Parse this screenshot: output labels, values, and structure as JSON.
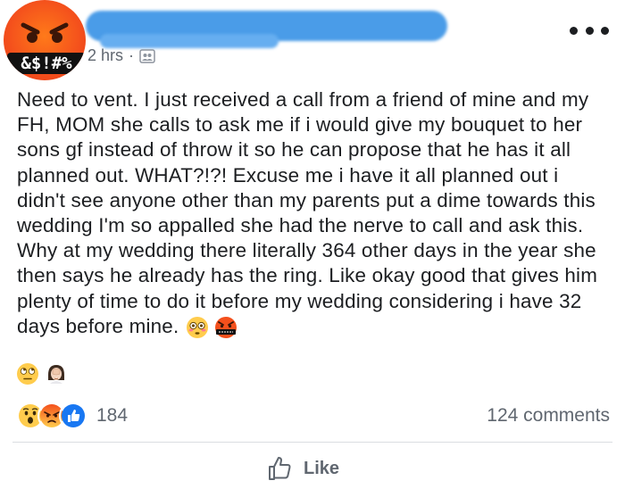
{
  "post": {
    "avatar_badge": "&$!#%",
    "timestamp": "2 hrs",
    "separator": "·",
    "body_text": "Need to vent. I just received a call from a friend of mine and my FH, MOM she calls to ask me if i would give my bouquet to her sons gf instead of throw it so he can propose that he has it all planned out. WHAT?!?! Excuse me i have it all planned out i didn't see anyone other than my parents put a dime towards this wedding I'm so appalled she had the nerve to call and ask this. Why at my wedding there literally 364 other days in the year she then says he already has the ring. Like okay good that gives him plenty of time to do it before my wedding considering i have 32 days before mine.",
    "trailing_emojis": [
      "flushed-face",
      "cursing-face",
      "eye-roll-face",
      "facepalm-woman"
    ]
  },
  "reactions": {
    "types": [
      "wow",
      "angry",
      "like"
    ],
    "count": "184",
    "comments": "124 comments"
  },
  "actions": {
    "like_label": "Like"
  },
  "colors": {
    "facebook_blue": "#1877f2",
    "meta_gray": "#606770",
    "angry_orange": "#f4501c"
  }
}
